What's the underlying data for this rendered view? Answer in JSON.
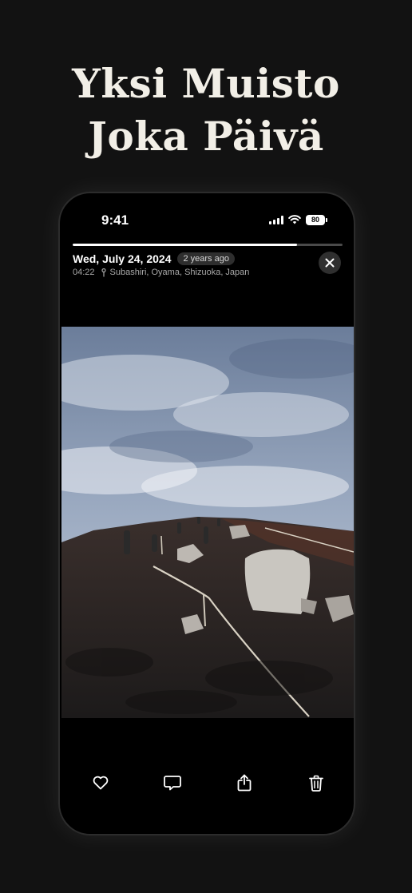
{
  "headline": {
    "line1": "Yksi Muisto",
    "line2": "Joka Päivä"
  },
  "status_bar": {
    "time": "9:41",
    "battery": "80"
  },
  "story_progress": 0.83,
  "memory": {
    "date": "Wed, July 24, 2024",
    "ago": "2 years ago",
    "time": "04:22",
    "location": "Subashiri, Oyama, Shizuoka, Japan"
  },
  "icons": {
    "close": "close-icon",
    "like": "heart-icon",
    "comment": "comment-icon",
    "share": "share-icon",
    "delete": "trash-icon",
    "location": "location-pin-icon"
  },
  "colors": {
    "background": "#121212",
    "headline": "#f2efe7",
    "badge": "#2e2e2e"
  }
}
